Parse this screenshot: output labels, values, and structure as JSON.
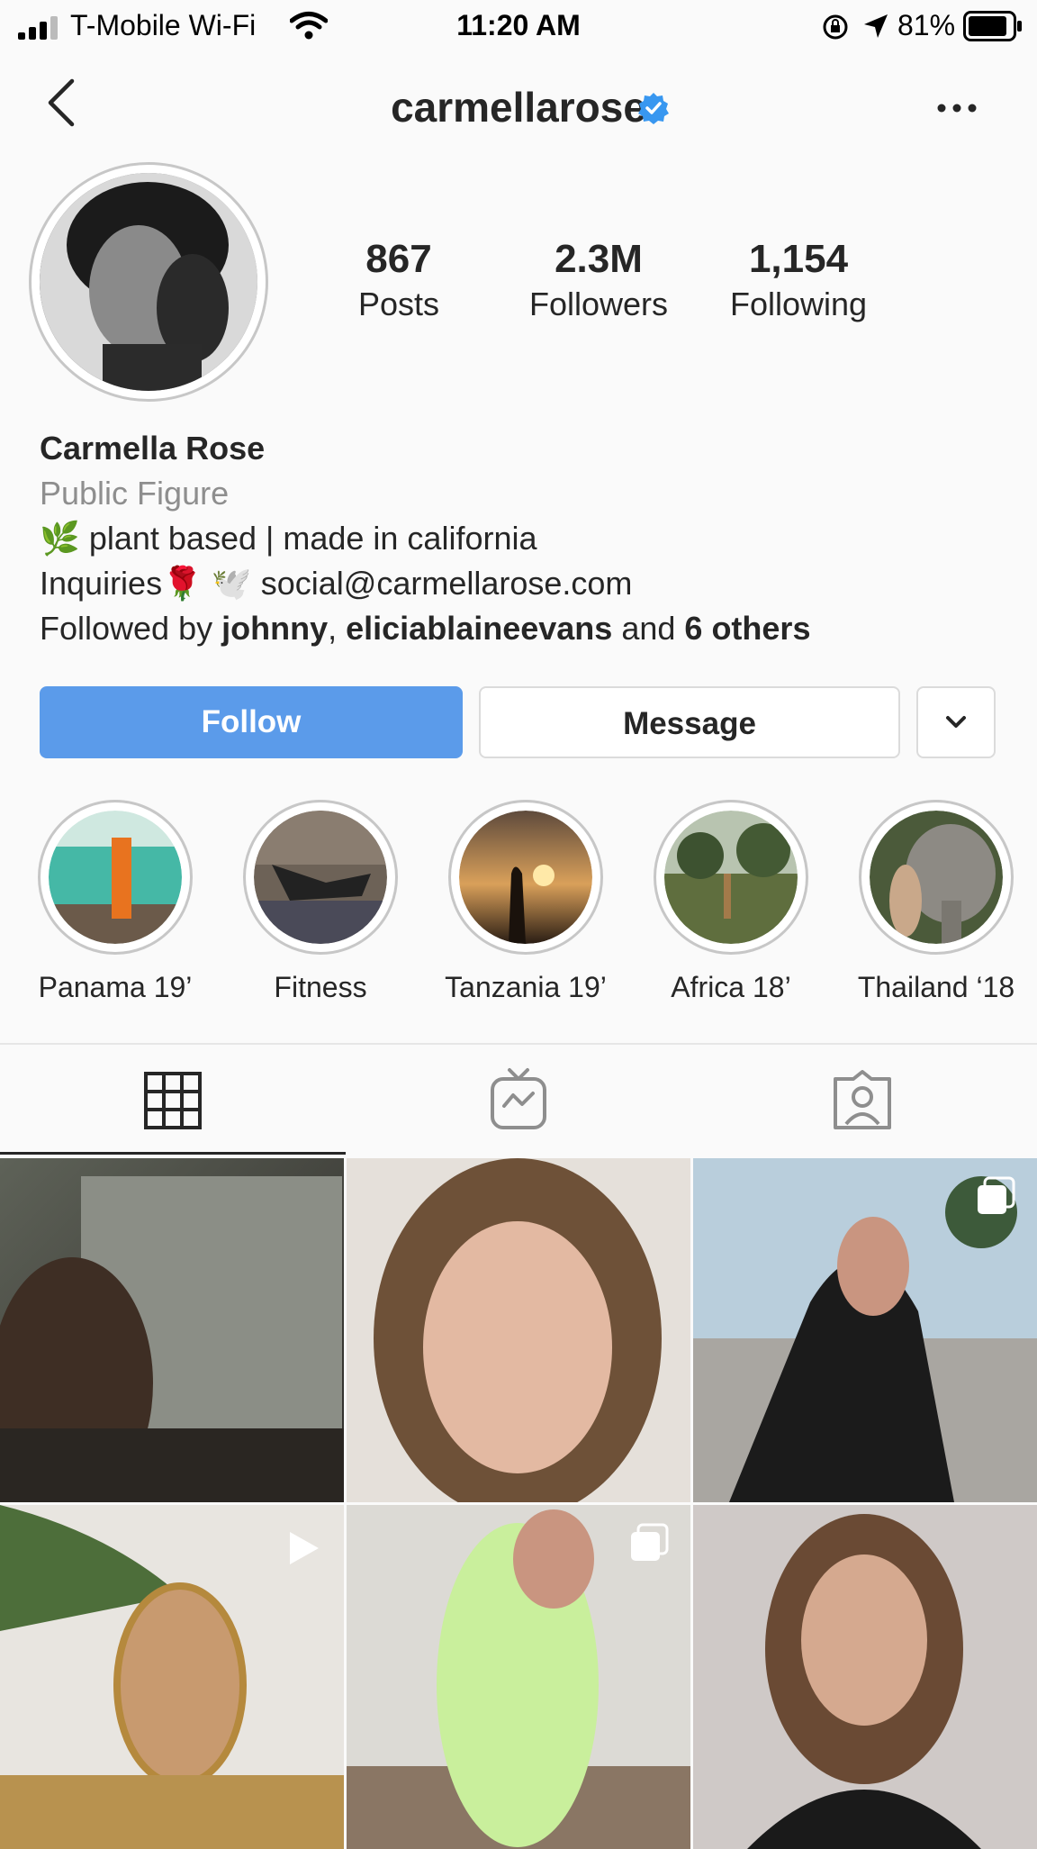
{
  "status_bar": {
    "carrier": "T-Mobile Wi-Fi",
    "time": "11:20 AM",
    "battery": "81%"
  },
  "nav": {
    "username": "carmellarose"
  },
  "stats": [
    {
      "value": "867",
      "label": "Posts"
    },
    {
      "value": "2.3M",
      "label": "Followers"
    },
    {
      "value": "1,154",
      "label": "Following"
    }
  ],
  "bio": {
    "name": "Carmella Rose",
    "category": "Public Figure",
    "line1_emoji": "🌿",
    "line1_text": "plant based | made in california",
    "line2_text": "Inquiries",
    "line2_emoji": "🌹 🕊️",
    "line2_email": "social@carmellarose.com",
    "followed_by_prefix": "Followed by",
    "followed_user1": "johnny",
    "followed_sep": ",",
    "followed_user2": "eliciablaineevans",
    "followed_and": "and",
    "followed_others": "6 others"
  },
  "buttons": {
    "follow": "Follow",
    "message": "Message"
  },
  "highlights": [
    {
      "label": "Panama 19’"
    },
    {
      "label": "Fitness"
    },
    {
      "label": "Tanzania 19’"
    },
    {
      "label": "Africa 18’"
    },
    {
      "label": "Thailand ‘18"
    }
  ],
  "colors": {
    "follow_button": "#5b9bea",
    "verified_badge": "#3897f0"
  }
}
